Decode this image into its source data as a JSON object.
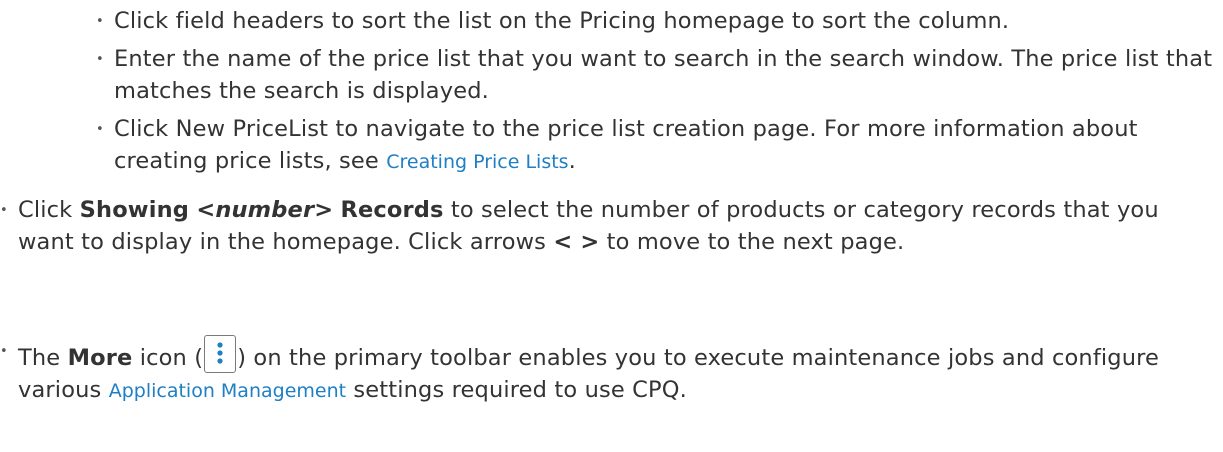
{
  "sub_bullets": [
    {
      "text": "Click field headers to sort the list on the Pricing homepage to sort the column."
    },
    {
      "text": "Enter the name of the price list that you want to search in the search window. The price list that matches the search is displayed."
    },
    {
      "text_before": "Click New PriceList to navigate to the price list creation page. For more information about creating price lists, see ",
      "link": "Creating Price Lists",
      "text_after": "."
    }
  ],
  "showing_bullet": {
    "text_before": "Click ",
    "bold_showing": "Showing",
    "italic_number": "<number>",
    "bold_records": "Records",
    "text_after": " to select the number of products or category records that you want to display in the homepage. Click arrows ",
    "bold_arrows": "< >",
    "text_end": " to move to the next page."
  },
  "more_bullet": {
    "text_before": "The ",
    "bold_more": "More",
    "text_icon_pre": " icon (",
    "icon": "vertical-ellipsis-icon",
    "text_after_icon": ") on the primary toolbar enables you to execute maintenance jobs and configure various ",
    "link": "Application Management",
    "text_end": " settings required to use CPQ."
  },
  "colors": {
    "text": "#333333",
    "link": "#1e7fc4"
  }
}
